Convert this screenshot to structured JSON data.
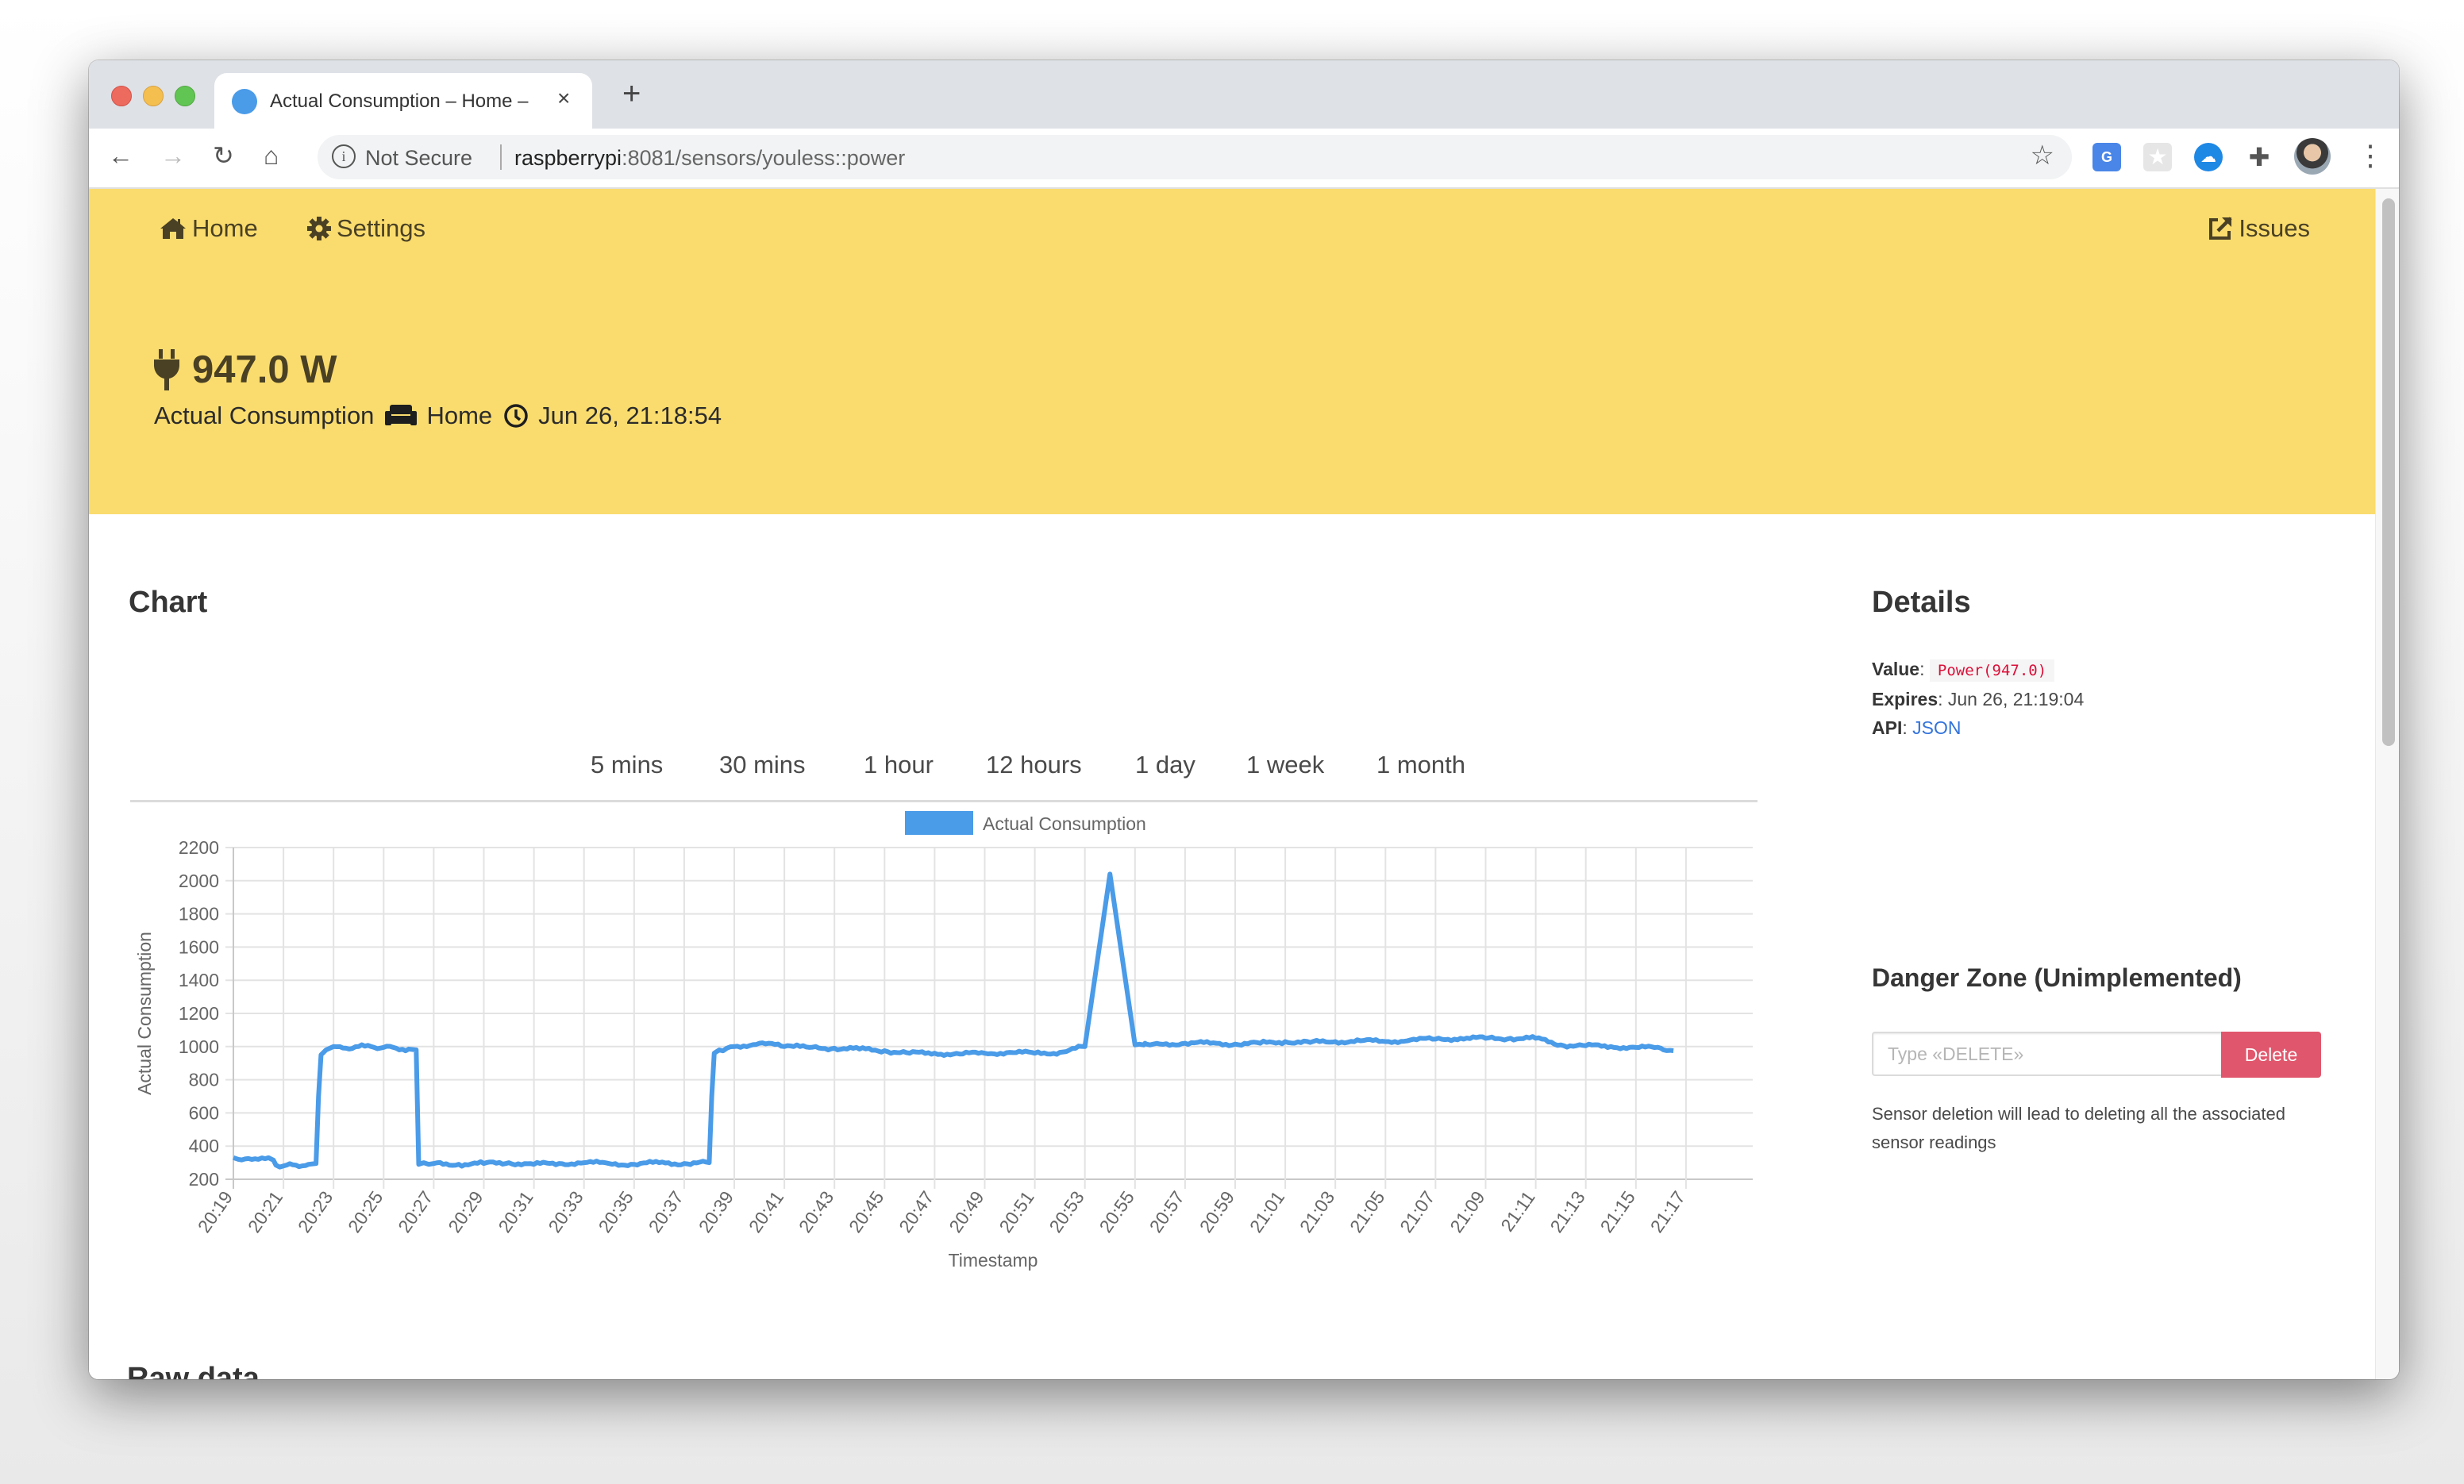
{
  "browser": {
    "tab_title": "Actual Consumption – Home –",
    "tab_close": "×",
    "new_tab": "+",
    "security_label": "Not Secure",
    "url_host": "raspberrypi",
    "url_rest": ":8081/sensors/youless::power",
    "extensions": [
      "google-translate",
      "bookmark-star",
      "cloud-key",
      "extensions-puzzle"
    ],
    "menu": "⋮"
  },
  "nav": {
    "home": "Home",
    "settings": "Settings",
    "issues": "Issues"
  },
  "hero": {
    "value": "947.0 W",
    "sensor_name": "Actual Consumption",
    "location": "Home",
    "timestamp": "Jun 26, 21:18:54"
  },
  "chart_section": {
    "title": "Chart",
    "ranges": [
      "5 mins",
      "30 mins",
      "1 hour",
      "12 hours",
      "1 day",
      "1 week",
      "1 month"
    ]
  },
  "details": {
    "title": "Details",
    "value_label": "Value",
    "value": "Power(947.0)",
    "expires_label": "Expires",
    "expires": "Jun 26, 21:19:04",
    "api_label": "API",
    "api_link": "JSON"
  },
  "danger": {
    "title": "Danger Zone (Unimplemented)",
    "placeholder": "Type «DELETE»",
    "button": "Delete",
    "help": "Sensor deletion will lead to deleting all the associated sensor readings"
  },
  "raw_data_title": "Raw data",
  "colors": {
    "hero_bg": "#fadc6e",
    "line": "#4a9be8",
    "danger": "#e0566c",
    "link": "#3273dc",
    "code": "#da1039"
  },
  "chart_data": {
    "type": "line",
    "title": "",
    "legend": [
      "Actual Consumption"
    ],
    "legend_position": "top",
    "xlabel": "Timestamp",
    "ylabel": "Actual Consumption",
    "ylim": [
      200,
      2200
    ],
    "yticks": [
      200,
      400,
      600,
      800,
      1000,
      1200,
      1400,
      1600,
      1800,
      2000,
      2200
    ],
    "xticks": [
      "20:19",
      "20:21",
      "20:23",
      "20:25",
      "20:27",
      "20:29",
      "20:31",
      "20:33",
      "20:35",
      "20:37",
      "20:39",
      "20:41",
      "20:43",
      "20:45",
      "20:47",
      "20:49",
      "20:51",
      "20:53",
      "20:55",
      "20:57",
      "20:59",
      "21:01",
      "21:03",
      "21:05",
      "21:07",
      "21:09",
      "21:11",
      "21:13",
      "21:15",
      "21:17"
    ],
    "grid": true,
    "x_start": "20:19",
    "x_end": "21:18:54",
    "series": [
      {
        "name": "Actual Consumption",
        "x_minutes_from_2019": [
          0,
          0.2,
          0.6,
          1.0,
          1.4,
          1.6,
          1.7,
          2.0,
          2.5,
          3.0,
          3.3,
          3.4,
          3.5,
          3.7,
          4.0,
          4.5,
          5.0,
          5.5,
          6.0,
          6.5,
          7.0,
          7.3,
          7.4,
          7.6,
          7.8,
          8.0,
          9.0,
          10.0,
          11.0,
          12.0,
          13.0,
          14.0,
          15.0,
          16.0,
          17.0,
          18.0,
          19.0,
          19.1,
          19.2,
          19.4,
          19.7,
          20.0,
          21.0,
          22.0,
          22.5,
          23.0,
          24.0,
          25.0,
          26.0,
          27.0,
          28.0,
          29.0,
          30.0,
          31.0,
          32.0,
          33.0,
          34.0,
          35.0,
          36.0,
          36.35,
          36.4,
          36.45,
          36.6,
          37.0,
          38.0,
          39.0,
          40.0,
          41.0,
          42.0,
          43.0,
          44.0,
          45.0,
          46.0,
          47.0,
          48.0,
          49.0,
          50.0,
          51.0,
          52.0,
          53.0,
          54.0,
          55.0,
          56.0,
          57.0,
          57.1,
          57.5,
          58.0,
          59.0,
          59.9
        ],
        "values": [
          330,
          320,
          325,
          320,
          330,
          315,
          285,
          280,
          285,
          290,
          295,
          700,
          950,
          980,
          1000,
          990,
          1000,
          1000,
          995,
          990,
          985,
          980,
          290,
          300,
          290,
          295,
          290,
          295,
          300,
          290,
          295,
          300,
          295,
          290,
          300,
          295,
          300,
          700,
          960,
          980,
          990,
          1000,
          1020,
          1000,
          1010,
          995,
          990,
          985,
          975,
          960,
          960,
          955,
          960,
          965,
          960,
          965,
          1000,
          2040,
          1010,
          1010,
          1020,
          1015,
          1010,
          1015,
          1020,
          1020,
          1015,
          1020,
          1030,
          1025,
          1030,
          1035,
          1030,
          1040,
          1045,
          1050,
          1050,
          1050,
          1050,
          1010,
          1005,
          1000,
          995,
          990,
          980,
          975
        ],
        "color": "#4a9be8"
      }
    ]
  }
}
